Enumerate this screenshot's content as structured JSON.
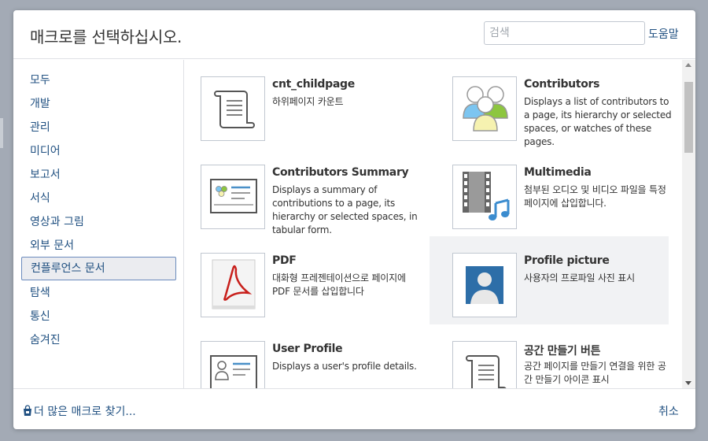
{
  "dialog": {
    "title": "매크로를 선택하십시오.",
    "search": {
      "placeholder": "검색",
      "value": ""
    },
    "help_label": "도움말"
  },
  "categories": [
    {
      "label": "모두",
      "active": false
    },
    {
      "label": "개발",
      "active": false
    },
    {
      "label": "관리",
      "active": false
    },
    {
      "label": "미디어",
      "active": false
    },
    {
      "label": "보고서",
      "active": false
    },
    {
      "label": "서식",
      "active": false
    },
    {
      "label": "영상과 그림",
      "active": false
    },
    {
      "label": "외부 문서",
      "active": false
    },
    {
      "label": "컨플루언스 문서",
      "active": true
    },
    {
      "label": "탐색",
      "active": false
    },
    {
      "label": "통신",
      "active": false
    },
    {
      "label": "숨겨진",
      "active": false
    }
  ],
  "macros": [
    {
      "title": "cnt_childpage",
      "description": "하위페이지 카운트",
      "icon": "scroll-icon"
    },
    {
      "title": "Contributors",
      "description": "Displays a list of contributors to a page, its hierarchy or selected spaces, or watches of these pages.",
      "icon": "contributors-icon"
    },
    {
      "title": "Contributors Summary",
      "description": "Displays a summary of contributions to a page, its hierarchy or selected spaces, in tabular form.",
      "icon": "contributors-summary-icon"
    },
    {
      "title": "Multimedia",
      "description": "첨부된 오디오 및 비디오 파일을 특정 페이지에 삽입합니다.",
      "icon": "multimedia-icon"
    },
    {
      "title": "PDF",
      "description": "대화형 프레젠테이션으로 페이지에 PDF 문서를 삽입합니다",
      "icon": "pdf-icon"
    },
    {
      "title": "Profile picture",
      "description": "사용자의 프로파일 사진 표시",
      "icon": "profile-picture-icon"
    },
    {
      "title": "User Profile",
      "description": "Displays a user's profile details.",
      "icon": "user-profile-icon"
    },
    {
      "title": "공간 만들기 버튼",
      "description": "공간 페이지를 만들기 연결을 위한 공간 만들기 아이콘 표시",
      "icon": "scroll-icon"
    }
  ],
  "footer": {
    "find_more_label": "더 많은 매크로 찾기...",
    "cancel_label": "취소"
  },
  "colors": {
    "link": "#205081",
    "highlight": "#f1f2f4",
    "active_border": "#6b8bbd"
  }
}
